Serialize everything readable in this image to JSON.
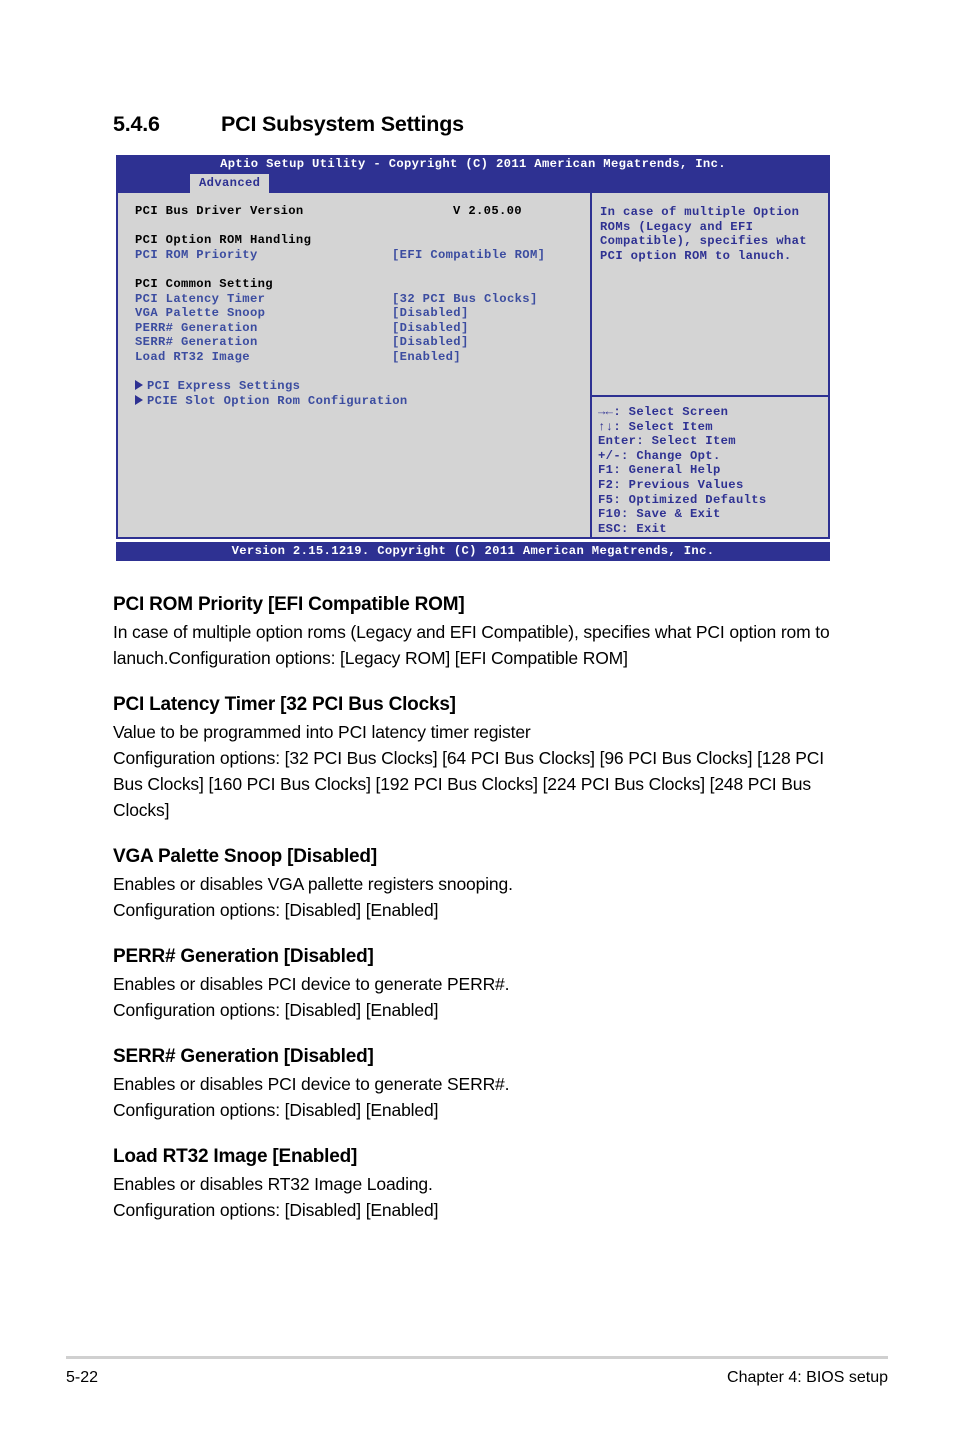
{
  "heading": {
    "number": "5.4.6",
    "title": "PCI Subsystem Settings"
  },
  "bios": {
    "titlebar": "Aptio Setup Utility - Copyright (C) 2011 American Megatrends, Inc.",
    "active_tab": "Advanced",
    "footer": "Version 2.15.1219. Copyright (C) 2011 American Megatrends, Inc.",
    "items": [
      {
        "label": "PCI Bus Driver Version",
        "value": "V 2.05.00",
        "style": "black-info"
      },
      {
        "label": "",
        "value": "",
        "style": "spacer"
      },
      {
        "label": "PCI Option ROM Handling",
        "value": "",
        "style": "header"
      },
      {
        "label": "PCI ROM Priority",
        "value": "[EFI Compatible ROM]",
        "style": "option"
      },
      {
        "label": "",
        "value": "",
        "style": "spacer"
      },
      {
        "label": "PCI Common Setting",
        "value": "",
        "style": "header"
      },
      {
        "label": "PCI Latency Timer",
        "value": "[32 PCI Bus Clocks]",
        "style": "option"
      },
      {
        "label": "VGA Palette Snoop",
        "value": "[Disabled]",
        "style": "option"
      },
      {
        "label": "PERR# Generation",
        "value": "[Disabled]",
        "style": "option"
      },
      {
        "label": "SERR# Generation",
        "value": "[Disabled]",
        "style": "option"
      },
      {
        "label": "Load RT32 Image",
        "value": "[Enabled]",
        "style": "option"
      }
    ],
    "submenus": [
      {
        "label": "PCI Express Settings"
      },
      {
        "label": "PCIE Slot Option Rom Configuration"
      }
    ],
    "help_lines": [
      "In case of multiple Option",
      "ROMs (Legacy and EFI",
      "Compatible), specifies what",
      "PCI option ROM to lanuch."
    ],
    "key_legend": [
      "→←: Select Screen",
      "↑↓:  Select Item",
      "Enter: Select Item",
      "+/-: Change Opt.",
      "F1: General Help",
      "F2: Previous Values",
      "F5: Optimized Defaults",
      "F10: Save & Exit",
      "ESC: Exit"
    ],
    "colors": {
      "chrome_blue": "#2e3192",
      "panel_gray": "#d4d4d4",
      "option_blue": "#3b4ca0"
    }
  },
  "sections": [
    {
      "title": "PCI ROM Priority [EFI Compatible ROM]",
      "lines": [
        "In case of multiple option roms (Legacy and EFI Compatible), specifies what PCI option rom to lanuch.Configuration options: [Legacy ROM] [EFI Compatible ROM]"
      ]
    },
    {
      "title": "PCI Latency Timer [32 PCI Bus Clocks]",
      "lines": [
        "Value to be programmed into PCI latency timer register",
        "Configuration options: [32 PCI Bus Clocks] [64 PCI Bus Clocks] [96 PCI Bus Clocks] [128 PCI Bus Clocks] [160 PCI Bus Clocks] [192 PCI Bus Clocks] [224 PCI Bus Clocks] [248 PCI Bus Clocks]"
      ]
    },
    {
      "title": "VGA Palette Snoop [Disabled]",
      "lines": [
        "Enables or disables VGA pallette registers snooping.",
        "Configuration options: [Disabled] [Enabled]"
      ]
    },
    {
      "title": "PERR# Generation [Disabled]",
      "lines": [
        "Enables or disables PCI device to generate PERR#.",
        "Configuration options: [Disabled] [Enabled]"
      ]
    },
    {
      "title": "SERR# Generation [Disabled]",
      "lines": [
        "Enables or disables PCI device to generate SERR#.",
        "Configuration options: [Disabled] [Enabled]"
      ]
    },
    {
      "title": "Load RT32 Image [Enabled]",
      "lines": [
        "Enables or disables RT32 Image Loading.",
        "Configuration options: [Disabled] [Enabled]"
      ]
    }
  ],
  "footer": {
    "page_number": "5-22",
    "chapter": "Chapter 4: BIOS setup"
  }
}
